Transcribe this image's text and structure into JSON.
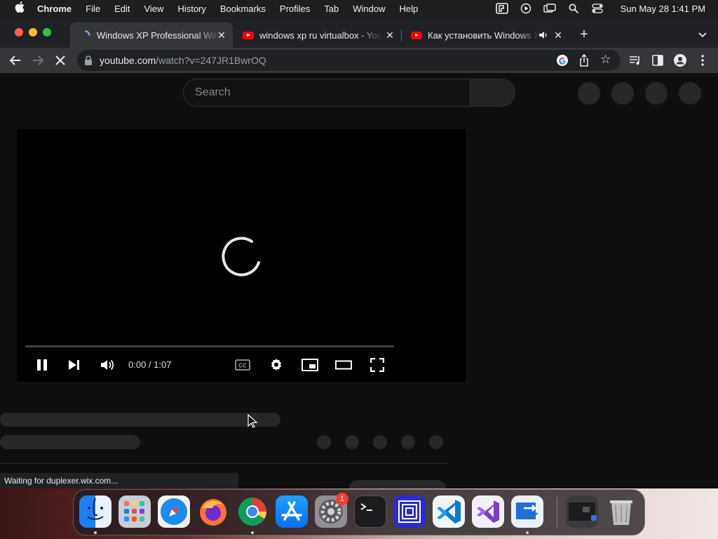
{
  "menubar": {
    "app": "Chrome",
    "items": [
      "File",
      "Edit",
      "View",
      "History",
      "Bookmarks",
      "Profiles",
      "Tab",
      "Window",
      "Help"
    ],
    "clock": "Sun May 28  1:41 PM"
  },
  "tabs": [
    {
      "title": "Windows XP Professional With",
      "favicon": "loading-icon",
      "active": true
    },
    {
      "title": "windows xp ru virtualbox - You",
      "favicon": "youtube-icon",
      "active": false
    },
    {
      "title": "Как установить Windows X",
      "favicon": "youtube-icon",
      "active": false,
      "audio": true
    }
  ],
  "omnibox": {
    "host": "youtube.com",
    "path": "/watch?v=247JR1BwrOQ"
  },
  "page": {
    "search_placeholder": "Search",
    "player": {
      "time": "0:00 / 1:07",
      "progress": 0
    },
    "status_text": "Waiting for duplexer.wix.com..."
  },
  "dock": {
    "apps": [
      "Finder",
      "Launchpad",
      "Safari",
      "Firefox",
      "Chrome",
      "App Store",
      "System Preferences",
      "Terminal",
      "Remote Desktop",
      "VS Code",
      "Visual Studio",
      "Parallels Client",
      "Screenshot",
      "Trash"
    ],
    "badge": "1"
  },
  "colors": {
    "youtube_red": "#ff0000",
    "chrome_tab_bg": "#202124",
    "chrome_toolbar": "#35363a",
    "page_bg": "#0f0f0f"
  }
}
